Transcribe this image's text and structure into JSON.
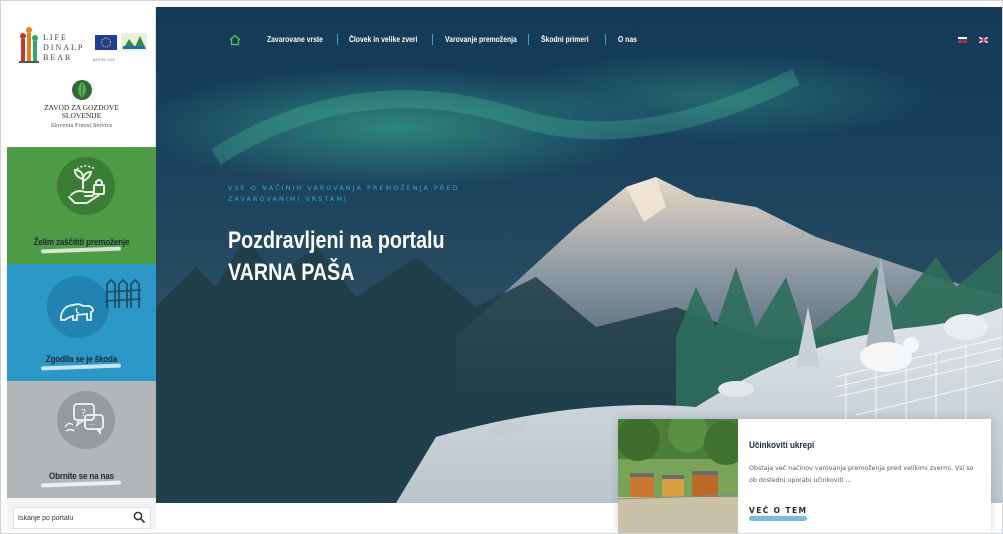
{
  "sidebar": {
    "logo_life": [
      "LIFE",
      "DINALP",
      "BEAR"
    ],
    "logo_eu_caption": "NATURA 2000",
    "org_name_line1": "ZAVOD ZA GOZDOVE",
    "org_name_line2": "SLOVENIJE",
    "org_name_en": "Slovenia Forest Service",
    "panels": [
      {
        "label": "Želim zaščititi premoženje",
        "color": "#4f9a47"
      },
      {
        "label": "Zgodila se je škoda",
        "color": "#2c98c8"
      },
      {
        "label": "Obrnite se na nas",
        "color": "#b2b6b9"
      }
    ],
    "search_placeholder": "Iskanje po portalu"
  },
  "nav": {
    "items": [
      "Zavarovane vrste",
      "Človek in velike zveri",
      "Varovanje premoženja",
      "Škodni primeri",
      "O nas"
    ],
    "accent": "#3f9bd6"
  },
  "hero": {
    "tagline": "VSE O NAČINIH VAROVANJA PREMOŽENJA PRED ZAVAROVANIMI VRSTAMI",
    "title_line1": "Pozdravljeni na portalu",
    "title_line2": "VARNA PAŠA"
  },
  "card": {
    "title": "Učinkoviti ukrepi",
    "text": "Obstaja več načinov varovanja premoženja pred velikimi zvermi. Vsi so ob dosledni uporabi učinkoviti ...",
    "more": "VEČ O TEM"
  }
}
